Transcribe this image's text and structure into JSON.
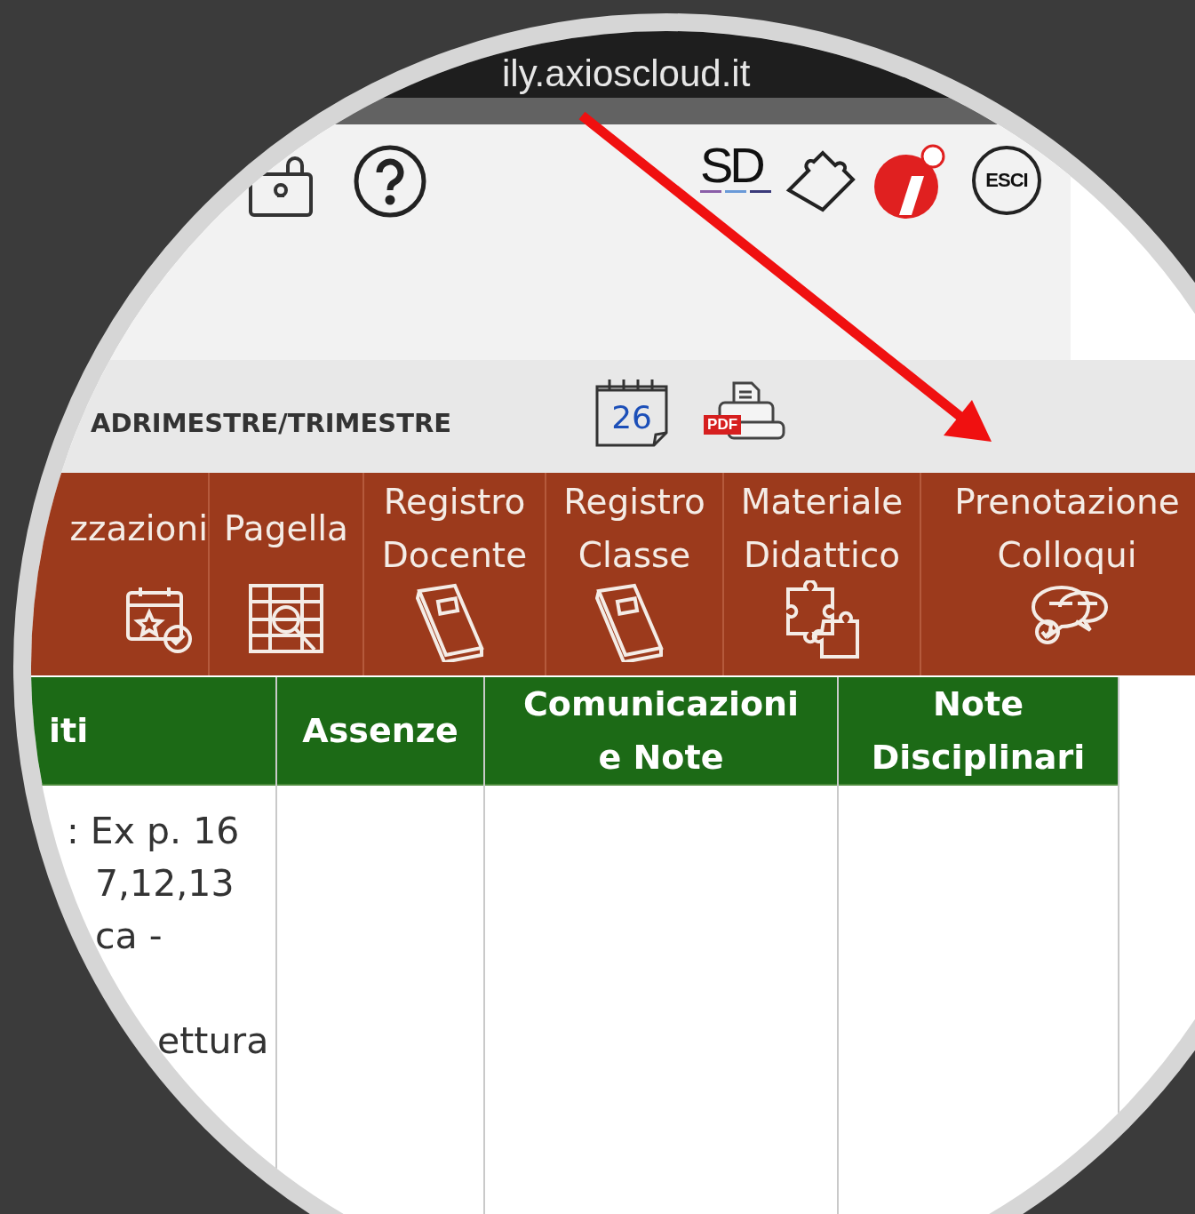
{
  "address_bar": {
    "url": "ily.axioscloud.it"
  },
  "header": {
    "exit_label": "ESCI",
    "logo_text": "SD"
  },
  "toolbar": {
    "title": "ADRIMESTRE/TRIMESTRE",
    "calendar_day": "26",
    "pdf_label": "PDF"
  },
  "menu": [
    {
      "lines": [
        "zzazioni"
      ],
      "kind": "calendar"
    },
    {
      "lines": [
        "Pagella"
      ],
      "kind": "grades"
    },
    {
      "lines": [
        "Registro",
        "Docente"
      ],
      "kind": "book"
    },
    {
      "lines": [
        "Registro",
        "Classe"
      ],
      "kind": "book"
    },
    {
      "lines": [
        "Materiale",
        "Didattico"
      ],
      "kind": "puzzle"
    },
    {
      "lines": [
        "Prenotazione",
        "Colloqui"
      ],
      "kind": "chat"
    }
  ],
  "table": {
    "columns": [
      [
        "iti"
      ],
      [
        "Assenze"
      ],
      [
        "Comunicazioni",
        "e Note"
      ],
      [
        "Note",
        "Disciplinari"
      ]
    ],
    "rows": [
      {
        "column_1_lines": [
          ": Ex p. 16",
          "7,12,13",
          "ca -",
          "ettura"
        ]
      }
    ]
  }
}
